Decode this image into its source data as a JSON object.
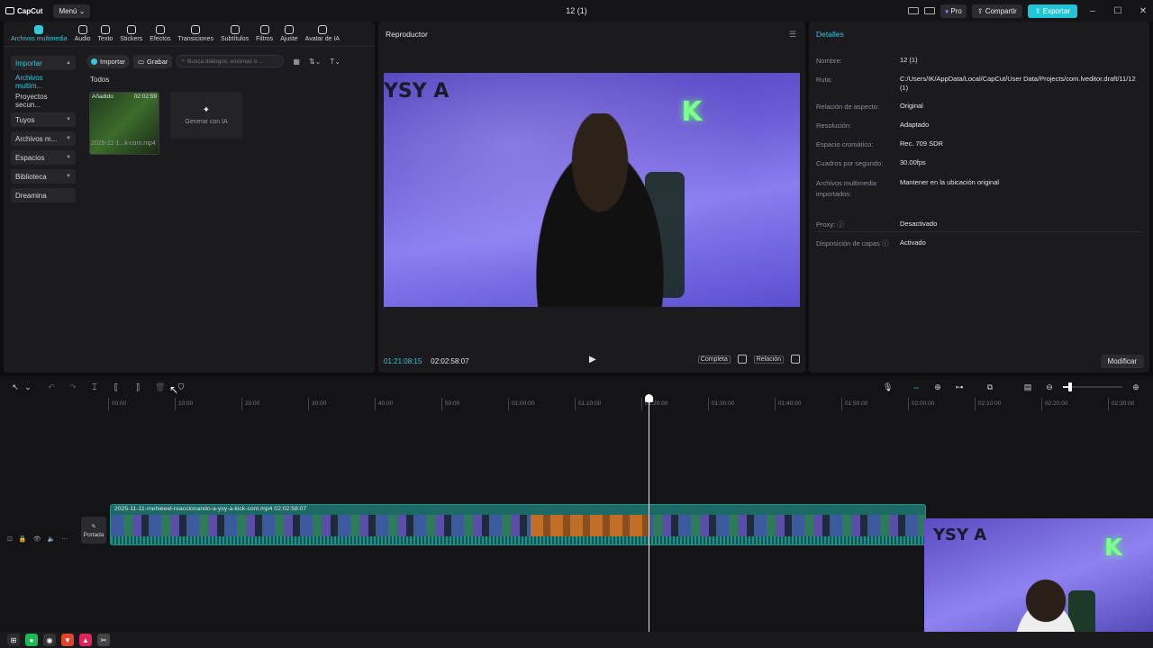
{
  "titlebar": {
    "logo": "CapCut",
    "menu": "Menú",
    "project_title": "12 (1)",
    "pro": "Pro",
    "share": "Compartir",
    "export": "Exportar"
  },
  "tool_tabs": [
    {
      "label": "Archivos multimedia",
      "icon": "media-icon"
    },
    {
      "label": "Audio",
      "icon": "audio-icon"
    },
    {
      "label": "Texto",
      "icon": "text-icon"
    },
    {
      "label": "Stickers",
      "icon": "sticker-icon"
    },
    {
      "label": "Efectos",
      "icon": "effects-icon"
    },
    {
      "label": "Transiciones",
      "icon": "transition-icon"
    },
    {
      "label": "Subtítulos",
      "icon": "subtitles-icon"
    },
    {
      "label": "Filtros",
      "icon": "filters-icon"
    },
    {
      "label": "Ajuste",
      "icon": "adjust-icon"
    },
    {
      "label": "Avatar de IA",
      "icon": "avatar-icon"
    }
  ],
  "side_nav": [
    {
      "label": "Importar",
      "caret": "▲"
    },
    {
      "label": "Archivos multim..."
    },
    {
      "label": "Proyectos secun..."
    },
    {
      "label": "Tuyos",
      "caret": "▼"
    },
    {
      "label": "Archivos m...",
      "caret": "▼"
    },
    {
      "label": "Espacios",
      "caret": "▼"
    },
    {
      "label": "Biblioteca",
      "caret": "▼"
    },
    {
      "label": "Dreamina"
    }
  ],
  "media": {
    "import_button": "Importar",
    "record_button": "Grabar",
    "search_placeholder": "Busca diálogos, escenas o ...",
    "section_label": "Todos",
    "thumb_tag": "Añadido",
    "thumb_duration": "02:02:59",
    "thumb_name": "2025-11-1...k-com.mp4",
    "generate_ai": "Generar con IA"
  },
  "player": {
    "title": "Reproductor",
    "current_time": "01:21:08:15",
    "total_time": "02:02:58:07",
    "complete": "Completa",
    "ratio": "Relación",
    "overlay_left": "YSY A",
    "overlay_right": "K"
  },
  "details": {
    "title": "Detalles",
    "rows": [
      {
        "key": "Nombre:",
        "value": "12 (1)"
      },
      {
        "key": "Ruta:",
        "value": "C:/Users/IK/AppData/Local/CapCut/User Data/Projects/com.lveditor.draft/11/12 (1)"
      },
      {
        "key": "Relación de aspecto:",
        "value": "Original"
      },
      {
        "key": "Resolución:",
        "value": "Adaptado"
      },
      {
        "key": "Espacio cromático:",
        "value": "Rec. 709 SDR"
      },
      {
        "key": "Cuadros por segundo:",
        "value": "30.00fps"
      },
      {
        "key": "Archivos multimedia importados:",
        "value": "Mantener en la ubicación original"
      },
      {
        "key": "Proxy:",
        "value": "Desactivado"
      },
      {
        "key": "Disposición de capas",
        "value": "Activado"
      }
    ],
    "modify": "Modificar"
  },
  "timeline": {
    "ruler": [
      "00:00",
      "10:00",
      "20:00",
      "30:00",
      "40:00",
      "50:00",
      "01:00:00",
      "01:10:00",
      "01:20:00",
      "01:30:00",
      "01:40:00",
      "01:50:00",
      "02:00:00",
      "02:10:00",
      "02:20:00",
      "02:30:00"
    ],
    "clip_label": "2025-11-11-mehieeel-reaccionando-a-ysy-a-kick-com.mp4   02:02:58:07",
    "cover_label": "Portada"
  },
  "webcam": {
    "overlay_left": "YSY A",
    "overlay_right": "K"
  },
  "colors": {
    "accent": "#35c8d9",
    "export": "#21c5d8",
    "clip": "#1c6a66"
  }
}
